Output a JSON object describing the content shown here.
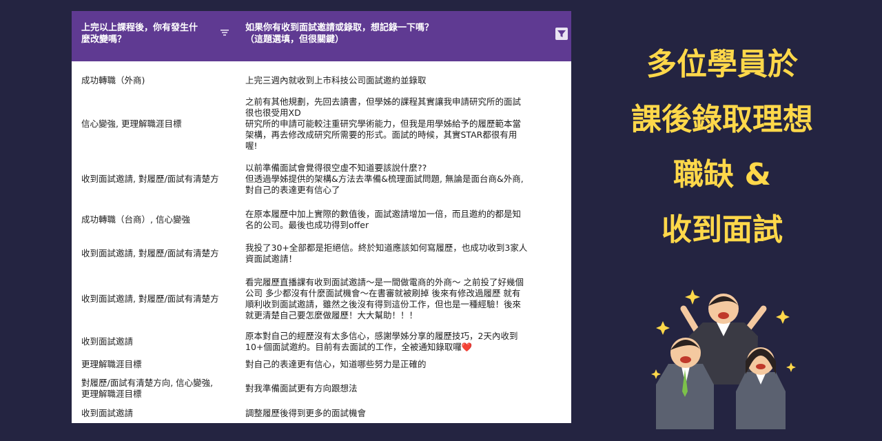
{
  "table": {
    "headers": {
      "col1": [
        "上完以上課程後，你有發生什",
        "麼改變嗎？"
      ],
      "col2": [
        "如果你有收到面試邀請或錄取，想記錄一下嗎？",
        "（這題選填，但很關鍵）"
      ]
    },
    "rows": [
      {
        "change": [
          "成功轉職（外商)"
        ],
        "record": [
          "上完三週內就收到上市科技公司面試邀約並錄取"
        ]
      },
      {
        "change": [
          "信心變強, 更理解職涯目標"
        ],
        "record": [
          "之前有其他規劃，先回去讀書，但學姊的課程其實讓我申請研究所的面試",
          "很也很受用XD",
          "研究所的申請可能較注重研究學術能力，但我是用學姊給予的履歷範本當",
          "架構，再去修改成研究所需要的形式。面試的時候，其實STAR都很有用",
          "喔!"
        ]
      },
      {
        "change": [
          "收到面試邀請, 對履歷/面試有清楚方"
        ],
        "record": [
          "以前準備面試會覺得很空虛不知道要該說什麼??",
          "但透過學姊提供的架構&方法去準備&梳理面試問題, 無論是面台商&外商,",
          "對自己的表達更有信心了"
        ]
      },
      {
        "change": [
          "成功轉職（台商）, 信心變強"
        ],
        "record": [
          "在原本履歷中加上實際的數值後，面試邀請增加一倍，而且邀約的都是知",
          "名的公司。最後也成功得到offer"
        ]
      },
      {
        "change": [
          "收到面試邀請, 對履歷/面試有清楚方"
        ],
        "record": [
          "我投了30+全部都是拒絕信。終於知道應該如何寫履歷，也成功收到3家人",
          "資面試邀請！"
        ]
      },
      {
        "change": [
          "收到面試邀請, 對履歷/面試有清楚方"
        ],
        "record": [
          "看完履歷直播課有收到面試邀請～是一間做電商的外商～ 之前投了好幾個",
          "公司 多少都沒有什麼面試機會～在書審就被刷掉 後來有修改過履歷 就有",
          "順利收到面試邀請，雖然之後沒有得到這份工作，但也是一種經驗！後來",
          "就更清楚自己要怎麼做履歷！大大幫助！！！"
        ]
      },
      {
        "change": [
          "收到面試邀請"
        ],
        "record": [
          "原本對自己的經歷沒有太多信心，感謝學姊分享的履歷技巧，2天內收到",
          "10+個面試邀約。目前有去面試的工作，全被通知錄取囉❤️"
        ]
      },
      {
        "change": [
          "更理解職涯目標"
        ],
        "record": [
          "對自己的表達更有信心，知道哪些努力是正確的"
        ]
      },
      {
        "change": [
          "對履歷/面試有清楚方向, 信心變強,",
          "更理解職涯目標"
        ],
        "record": [
          "對我準備面試更有方向跟想法"
        ]
      },
      {
        "change": [
          "收到面試邀請"
        ],
        "record": [
          "調整履歷後得到更多的面試機會"
        ]
      }
    ]
  },
  "headline": [
    "多位學員於",
    "課後錄取理想",
    "職缺 &",
    "收到面試"
  ],
  "icons": {
    "sort": "sort-icon",
    "filter": "filter-icon",
    "illustration": "cheering-people-icon"
  },
  "colors": {
    "background": "#242441",
    "header": "#5f3a92",
    "headline": "#ffd84a"
  }
}
